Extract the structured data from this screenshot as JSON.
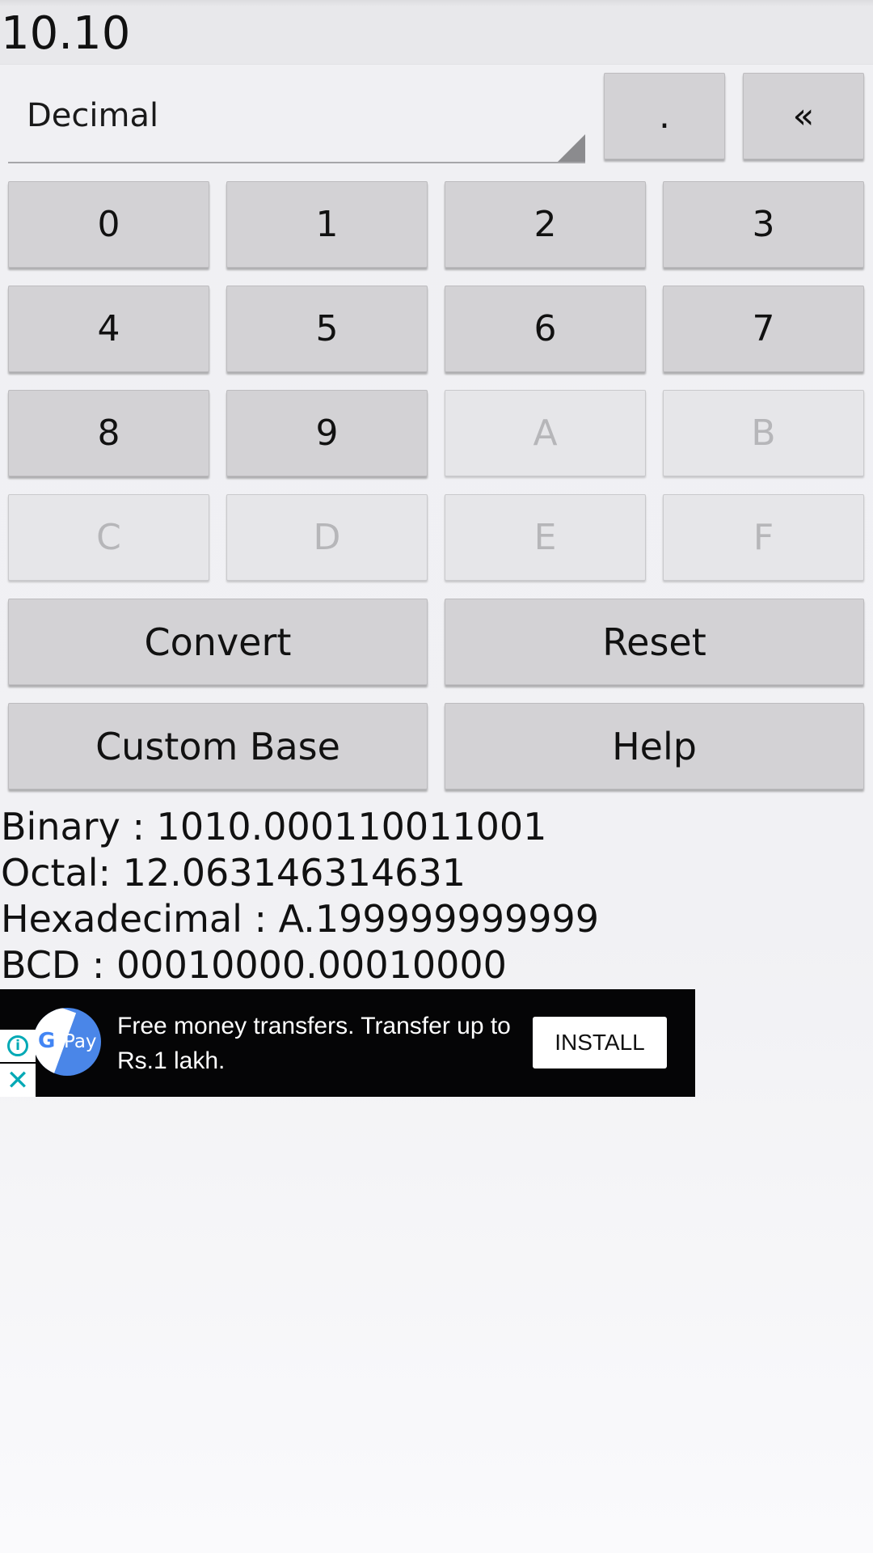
{
  "input": {
    "value": "10.10"
  },
  "base_selector": {
    "selected": "Decimal"
  },
  "top_buttons": {
    "dot_label": ".",
    "backspace_label": "«"
  },
  "keypad": {
    "k0": "0",
    "k1": "1",
    "k2": "2",
    "k3": "3",
    "k4": "4",
    "k5": "5",
    "k6": "6",
    "k7": "7",
    "k8": "8",
    "k9": "9",
    "kA": "A",
    "kB": "B",
    "kC": "C",
    "kD": "D",
    "kE": "E",
    "kF": "F"
  },
  "actions": {
    "convert_label": "Convert",
    "reset_label": "Reset",
    "custom_base_label": "Custom Base",
    "help_label": "Help"
  },
  "results": {
    "binary": "Binary : 1010.000110011001",
    "octal": "Octal: 12.063146314631",
    "hexadecimal": "Hexadecimal : A.199999999999",
    "bcd": "BCD : 00010000.00010000"
  },
  "ad": {
    "logo_g": "G",
    "logo_pay": "Pay",
    "info_glyph": "i",
    "close_glyph": "✕",
    "text": "Free money transfers. Transfer up to Rs.1 lakh.",
    "install_label": "INSTALL"
  },
  "colors": {
    "button_enabled": "#d3d2d5",
    "button_disabled": "#e6e6e9",
    "ad_background": "#050506",
    "ad_accent": "#00a9b5"
  }
}
